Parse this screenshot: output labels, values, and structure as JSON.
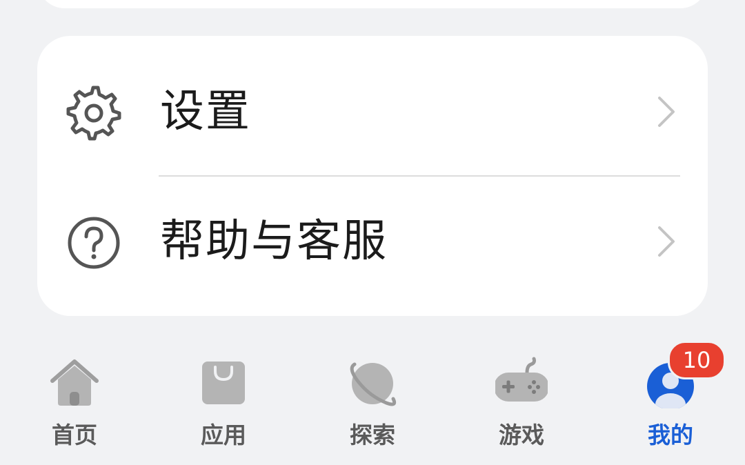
{
  "menu": {
    "items": [
      {
        "label": "设置",
        "icon": "gear-icon"
      },
      {
        "label": "帮助与客服",
        "icon": "question-circle-icon"
      }
    ]
  },
  "tabbar": {
    "tabs": [
      {
        "label": "首页",
        "icon": "home-icon",
        "active": false
      },
      {
        "label": "应用",
        "icon": "shopping-bag-icon",
        "active": false
      },
      {
        "label": "探索",
        "icon": "planet-icon",
        "active": false
      },
      {
        "label": "游戏",
        "icon": "gamepad-icon",
        "active": false
      },
      {
        "label": "我的",
        "icon": "user-avatar-icon",
        "active": true
      }
    ],
    "badge": "10"
  },
  "colors": {
    "background": "#f1f2f4",
    "card": "#ffffff",
    "active_tab": "#1a5fd6",
    "inactive_tab": "#5a5a5a",
    "badge": "#e8402f"
  }
}
